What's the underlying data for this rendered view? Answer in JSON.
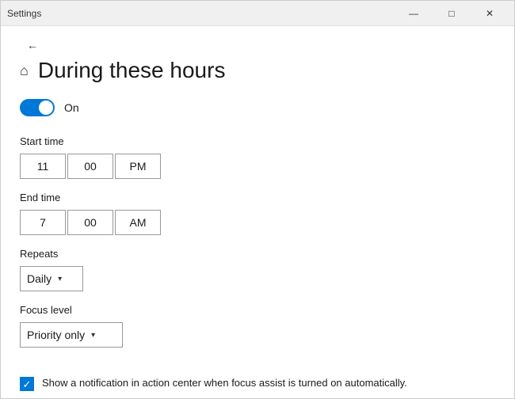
{
  "titleBar": {
    "title": "Settings",
    "minimize": "—",
    "maximize": "□",
    "close": "✕"
  },
  "page": {
    "homeIcon": "⌂",
    "title": "During these hours",
    "backArrow": "←"
  },
  "toggle": {
    "label": "On",
    "state": "on"
  },
  "startTime": {
    "label": "Start time",
    "hour": "11",
    "minute": "00",
    "period": "PM"
  },
  "endTime": {
    "label": "End time",
    "hour": "7",
    "minute": "00",
    "period": "AM"
  },
  "repeats": {
    "label": "Repeats",
    "value": "Daily"
  },
  "focusLevel": {
    "label": "Focus level",
    "value": "Priority only"
  },
  "notification": {
    "text": "Show a notification in action center when focus assist is turned on automatically."
  }
}
